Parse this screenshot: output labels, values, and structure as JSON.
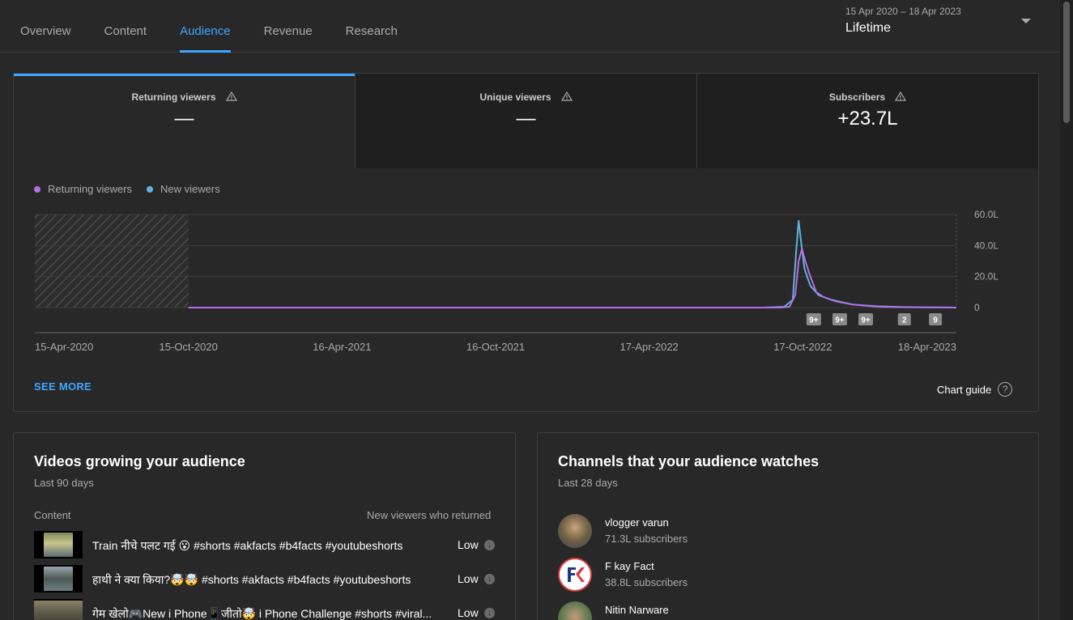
{
  "nav": {
    "tabs": [
      {
        "label": "Overview"
      },
      {
        "label": "Content"
      },
      {
        "label": "Audience"
      },
      {
        "label": "Revenue"
      },
      {
        "label": "Research"
      }
    ],
    "active_tab": "Audience",
    "date_range": "15 Apr 2020 – 18 Apr 2023",
    "period": "Lifetime"
  },
  "metrics": [
    {
      "label": "Returning viewers",
      "value": "—"
    },
    {
      "label": "Unique viewers",
      "value": "—"
    },
    {
      "label": "Subscribers",
      "value": "+23.7L"
    }
  ],
  "legend": [
    {
      "label": "Returning viewers",
      "color": "#b56ee8"
    },
    {
      "label": "New viewers",
      "color": "#5fb3e0"
    }
  ],
  "chart_data": {
    "type": "line",
    "x_ticks": [
      "15-Apr-2020",
      "15-Oct-2020",
      "16-Apr-2021",
      "16-Oct-2021",
      "17-Apr-2022",
      "17-Oct-2022",
      "18-Apr-2023"
    ],
    "y_ticks": [
      "60.0L",
      "40.0L",
      "20.0L",
      "0"
    ],
    "ylim": [
      0,
      60
    ],
    "grid": true,
    "unavailable_period": [
      "15-Apr-2020",
      "15-Oct-2020"
    ],
    "series": [
      {
        "name": "Returning viewers",
        "color": "#b56ee8",
        "points": [
          [
            "2020-10-15",
            0
          ],
          [
            "2022-09-20",
            0
          ],
          [
            "2022-10-01",
            0.5
          ],
          [
            "2022-10-08",
            8
          ],
          [
            "2022-10-12",
            30
          ],
          [
            "2022-10-16",
            38
          ],
          [
            "2022-10-20",
            30
          ],
          [
            "2022-10-26",
            20
          ],
          [
            "2022-11-02",
            10
          ],
          [
            "2022-11-10",
            7
          ],
          [
            "2022-11-25",
            4
          ],
          [
            "2022-12-15",
            2
          ],
          [
            "2023-01-15",
            0.5
          ],
          [
            "2023-02-15",
            0.2
          ],
          [
            "2023-04-18",
            0
          ]
        ]
      },
      {
        "name": "New viewers",
        "color": "#5fb3e0",
        "points": [
          [
            "2020-10-15",
            0
          ],
          [
            "2022-09-01",
            0
          ],
          [
            "2022-09-25",
            0.5
          ],
          [
            "2022-10-05",
            5
          ],
          [
            "2022-10-09",
            35
          ],
          [
            "2022-10-12",
            56
          ],
          [
            "2022-10-15",
            42
          ],
          [
            "2022-10-19",
            25
          ],
          [
            "2022-10-26",
            14
          ],
          [
            "2022-11-05",
            8
          ],
          [
            "2022-11-20",
            5
          ],
          [
            "2022-12-15",
            2
          ],
          [
            "2023-01-15",
            0.8
          ],
          [
            "2023-02-15",
            0.3
          ],
          [
            "2023-04-18",
            0
          ]
        ]
      }
    ],
    "annotations": [
      {
        "date": "2022-10-30",
        "label": "9+"
      },
      {
        "date": "2022-11-30",
        "label": "9+"
      },
      {
        "date": "2022-12-31",
        "label": "9+"
      },
      {
        "date": "2023-02-15",
        "label": "2"
      },
      {
        "date": "2023-03-24",
        "label": "9"
      }
    ]
  },
  "see_more": "SEE MORE",
  "chart_guide": "Chart guide",
  "videos_card": {
    "title": "Videos growing your audience",
    "subtitle": "Last 90 days",
    "col_content": "Content",
    "col_metric": "New viewers who returned",
    "rows": [
      {
        "title": "Train नीचे पलट गई 😮 #shorts #akfacts #b4facts #youtubeshorts",
        "level": "Low"
      },
      {
        "title": "हाथी ने क्या किया?🤯🤯 #shorts #akfacts #b4facts #youtubeshorts",
        "level": "Low"
      },
      {
        "title": "गेम खेलो🎮New i Phone📱जीतो🤯 i Phone Challenge #shorts #viral...",
        "level": "Low"
      }
    ]
  },
  "channels_card": {
    "title": "Channels that your audience watches",
    "subtitle": "Last 28 days",
    "rows": [
      {
        "name": "vlogger varun",
        "subs": "71.3L subscribers"
      },
      {
        "name": "F kay Fact",
        "subs": "38.8L subscribers"
      },
      {
        "name": "Nitin Narware",
        "subs": ""
      }
    ]
  }
}
